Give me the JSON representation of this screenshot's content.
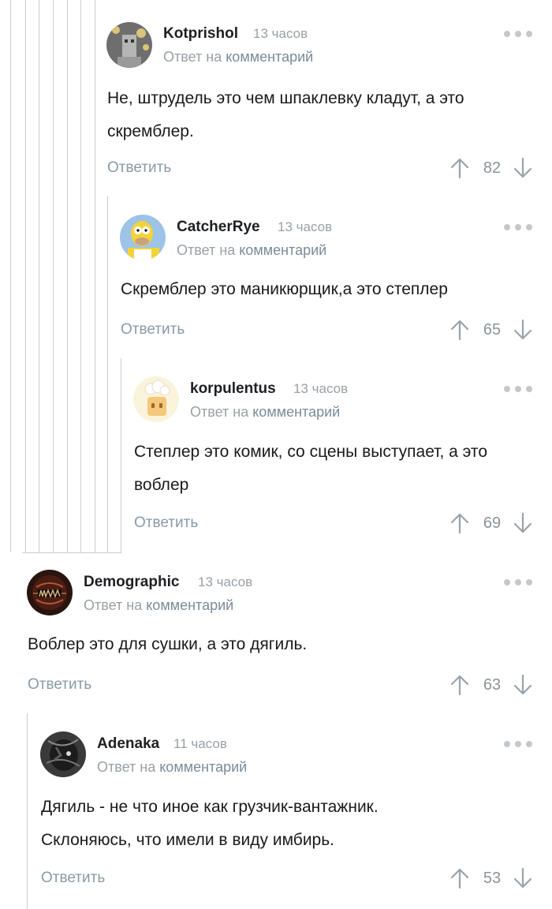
{
  "comments": [
    {
      "author": "Kotprishol",
      "time": "13 часов",
      "reply_prefix": "Ответ на",
      "reply_link": "комментарий",
      "text": "Не, штрудель это чем шпаклевку кладут, а это скремблер.",
      "reply_label": "Ответить",
      "rating": "82"
    },
    {
      "author": "CatcherRye",
      "time": "13 часов",
      "reply_prefix": "Ответ на",
      "reply_link": "комментарий",
      "text": "Скремблер это маникюрщик,а это степлер",
      "reply_label": "Ответить",
      "rating": "65"
    },
    {
      "author": "korpulentus",
      "time": "13 часов",
      "reply_prefix": "Ответ на",
      "reply_link": "комментарий",
      "text": "Степлер это комик, со сцены выступает, а это воблер",
      "reply_label": "Ответить",
      "rating": "69"
    },
    {
      "author": "Demographic",
      "time": "13 часов",
      "reply_prefix": "Ответ на",
      "reply_link": "комментарий",
      "text": "Воблер это для сушки, а это дягиль.",
      "reply_label": "Ответить",
      "rating": "63"
    },
    {
      "author": "Adenaka",
      "time": "11 часов",
      "reply_prefix": "Ответ на",
      "reply_link": "комментарий",
      "text": "Дягиль - не что иное как грузчик-вантажник. Склоняюсь, что имели в виду имбирь.",
      "reply_label": "Ответить",
      "rating": "53"
    }
  ],
  "icons": {
    "more": "more-dots-icon",
    "upvote": "arrow-up-icon",
    "downvote": "arrow-down-icon"
  },
  "colors": {
    "link": "#7a8b97",
    "muted": "#9aa0a6",
    "thread_line": "#c9ccd0"
  }
}
